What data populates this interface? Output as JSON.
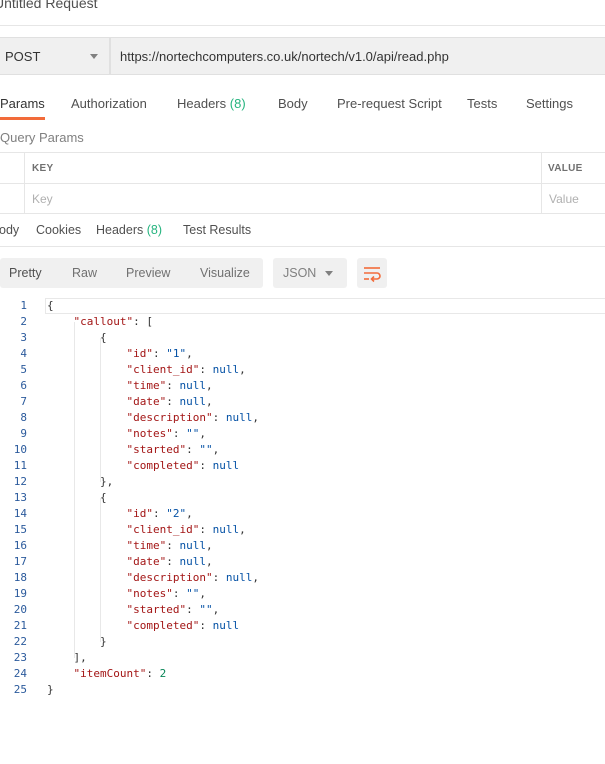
{
  "request": {
    "title": "Untitled Request",
    "method": "POST",
    "url": "https://nortechcomputers.co.uk/nortech/v1.0/api/read.php"
  },
  "request_tabs": [
    {
      "label": "Params",
      "active": true
    },
    {
      "label": "Authorization"
    },
    {
      "label": "Headers",
      "count": "(8)"
    },
    {
      "label": "Body"
    },
    {
      "label": "Pre-request Script"
    },
    {
      "label": "Tests"
    },
    {
      "label": "Settings"
    }
  ],
  "query_params": {
    "title": "Query Params",
    "key_header": "KEY",
    "value_header": "VALUE",
    "key_placeholder": "Key",
    "value_placeholder": "Value"
  },
  "response_tabs": [
    {
      "label": "Body",
      "visible_label": "ody",
      "active": true
    },
    {
      "label": "Cookies"
    },
    {
      "label": "Headers",
      "count": "(8)"
    },
    {
      "label": "Test Results"
    }
  ],
  "view_modes": [
    "Pretty",
    "Raw",
    "Preview",
    "Visualize"
  ],
  "language": "JSON",
  "icons": {
    "wrap": "wrap-lines-icon",
    "caret": "chevron-down-icon"
  },
  "colors": {
    "accent": "#f26b3a",
    "count": "#26b47f",
    "key": "#a31515",
    "string": "#0451a5",
    "number": "#098658"
  },
  "response_lines": [
    "{",
    "    \"callout\": [",
    "        {",
    "            \"id\": \"1\",",
    "            \"client_id\": null,",
    "            \"time\": null,",
    "            \"date\": null,",
    "            \"description\": null,",
    "            \"notes\": \"\",",
    "            \"started\": \"\",",
    "            \"completed\": null",
    "        },",
    "        {",
    "            \"id\": \"2\",",
    "            \"client_id\": null,",
    "            \"time\": null,",
    "            \"date\": null,",
    "            \"description\": null,",
    "            \"notes\": \"\",",
    "            \"started\": \"\",",
    "            \"completed\": null",
    "        }",
    "    ],",
    "    \"itemCount\": 2",
    "}"
  ]
}
